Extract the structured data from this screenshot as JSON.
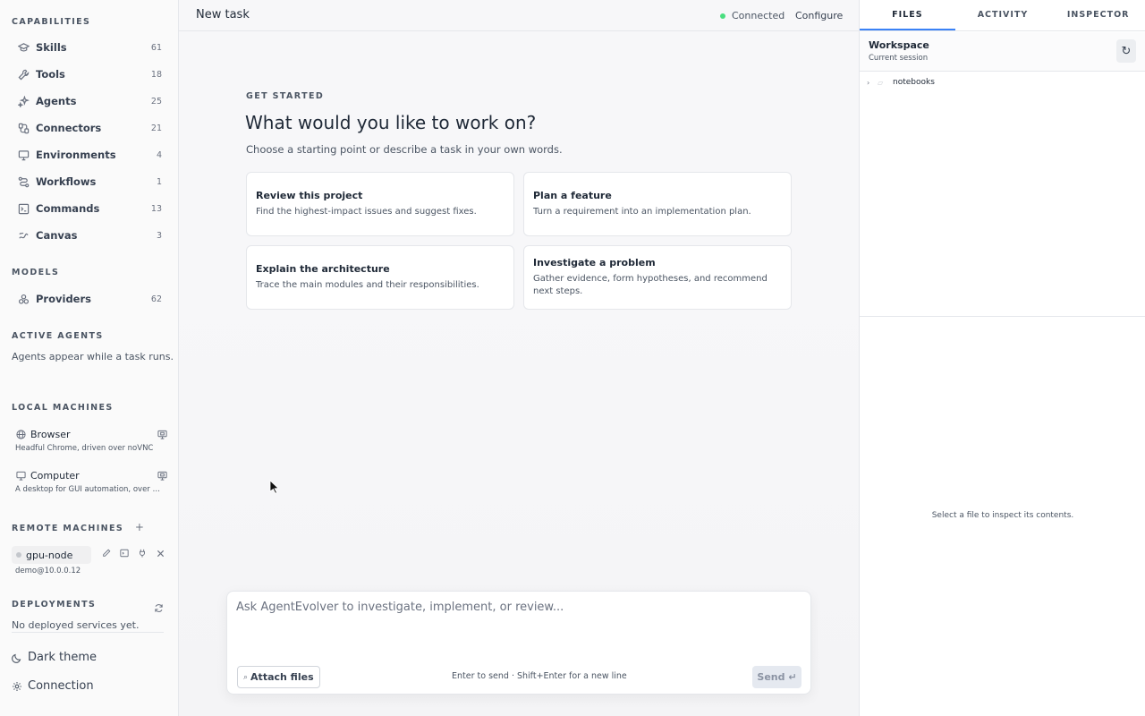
{
  "sidebar": {
    "capabilities_title": "CAPABILITIES",
    "capabilities": [
      {
        "label": "Skills",
        "count": "61",
        "icon": "skills-icon"
      },
      {
        "label": "Tools",
        "count": "18",
        "icon": "wrench-icon"
      },
      {
        "label": "Agents",
        "count": "25",
        "icon": "sparkles-icon"
      },
      {
        "label": "Connectors",
        "count": "21",
        "icon": "plug-icon"
      },
      {
        "label": "Environments",
        "count": "4",
        "icon": "monitor-icon"
      },
      {
        "label": "Workflows",
        "count": "1",
        "icon": "route-icon"
      },
      {
        "label": "Commands",
        "count": "13",
        "icon": "terminal-icon"
      },
      {
        "label": "Canvas",
        "count": "3",
        "icon": "squiggle-icon"
      }
    ],
    "models_title": "MODELS",
    "models": [
      {
        "label": "Providers",
        "count": "62",
        "icon": "boxes-icon"
      }
    ],
    "active_agents_title": "ACTIVE AGENTS",
    "active_agents_hint": "Agents appear while a task runs.",
    "local_machines_title": "LOCAL MACHINES",
    "local_machines": [
      {
        "name": "Browser",
        "desc": "Headful Chrome, driven over noVNC",
        "icon": "globe-icon"
      },
      {
        "name": "Computer",
        "desc": "A desktop for GUI automation, over noVNC",
        "icon": "monitor-icon"
      }
    ],
    "remote_machines_title": "REMOTE MACHINES",
    "remote_add": "+",
    "remote_machine": {
      "name": "gpu-node",
      "address": "demo@10.0.0.12"
    },
    "deployments_title": "DEPLOYMENTS",
    "deployments_hint": "No deployed services yet.",
    "dark_theme": "Dark theme",
    "connection": "Connection"
  },
  "header": {
    "title": "New task",
    "status": "Connected",
    "configure": "Configure",
    "status_color": "#4ade80"
  },
  "main": {
    "eyebrow": "GET STARTED",
    "headline": "What would you like to work on?",
    "subtitle": "Choose a starting point or describe a task in your own words.",
    "cards": [
      {
        "title": "Review this project",
        "desc": "Find the highest-impact issues and suggest fixes."
      },
      {
        "title": "Plan a feature",
        "desc": "Turn a requirement into an implementation plan."
      },
      {
        "title": "Explain the architecture",
        "desc": "Trace the main modules and their responsibilities."
      },
      {
        "title": "Investigate a problem",
        "desc": "Gather evidence, form hypotheses, and recommend next steps."
      }
    ]
  },
  "composer": {
    "placeholder": "Ask AgentEvolver to investigate, implement, or review...",
    "attach_label": "Attach files",
    "hint": "Enter to send · Shift+Enter for a new line",
    "send_label": "Send ↵"
  },
  "right_panel": {
    "tabs": [
      "FILES",
      "ACTIVITY",
      "INSPECTOR"
    ],
    "active_tab": "FILES",
    "workspace_title": "Workspace",
    "workspace_sub": "Current session",
    "tree": [
      {
        "name": "notebooks"
      }
    ],
    "empty_inspect": "Select a file to inspect its contents."
  }
}
